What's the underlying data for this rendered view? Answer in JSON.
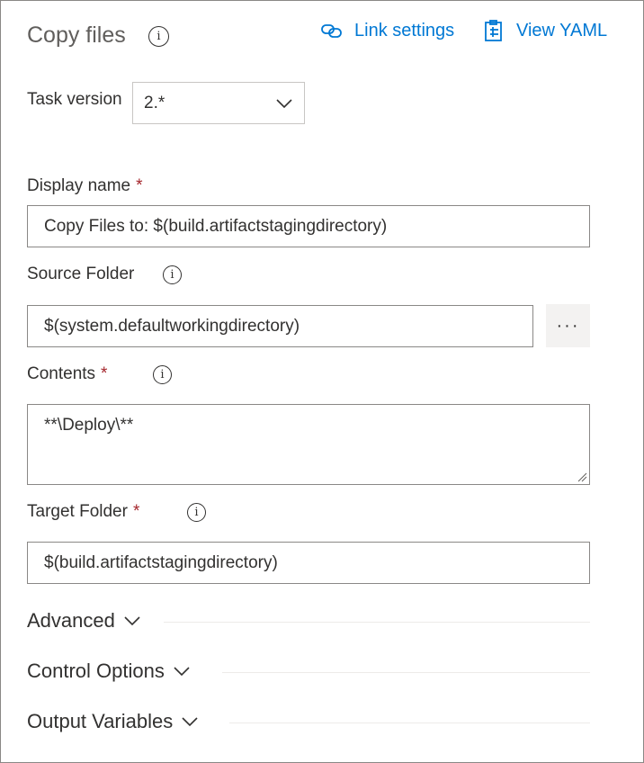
{
  "header": {
    "title": "Copy files",
    "link_settings": "Link settings",
    "view_yaml": "View YAML"
  },
  "task_version": {
    "label": "Task version",
    "value": "2.*"
  },
  "display_name": {
    "label": "Display name",
    "required": "*",
    "value": "Copy Files to: $(build.artifactstagingdirectory)"
  },
  "source_folder": {
    "label": "Source Folder",
    "value": "$(system.defaultworkingdirectory)",
    "browse_label": "···"
  },
  "contents": {
    "label": "Contents",
    "required": "*",
    "value": "**\\Deploy\\**"
  },
  "target_folder": {
    "label": "Target Folder",
    "required": "*",
    "value": "$(build.artifactstagingdirectory)"
  },
  "sections": {
    "advanced": "Advanced",
    "control_options": "Control Options",
    "output_variables": "Output Variables"
  },
  "colors": {
    "accent": "#0078d4",
    "required": "#a4262c",
    "text": "#323130",
    "muted_title": "#605e5c"
  },
  "icons": {
    "info": "info-icon",
    "link": "link-icon",
    "yaml": "clipboard-icon",
    "chevron": "chevron-down-icon"
  }
}
